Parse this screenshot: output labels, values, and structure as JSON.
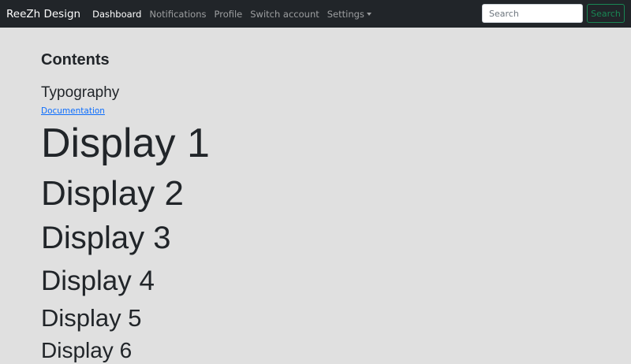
{
  "navbar": {
    "brand": "ReeZh Design",
    "links": [
      {
        "label": "Dashboard",
        "active": true
      },
      {
        "label": "Notifications",
        "active": false
      },
      {
        "label": "Profile",
        "active": false
      },
      {
        "label": "Switch account",
        "active": false
      },
      {
        "label": "Settings",
        "active": false,
        "dropdown": true
      }
    ],
    "search": {
      "placeholder": "Search",
      "value": "",
      "button_label": "Search"
    }
  },
  "main": {
    "title": "Contents",
    "section_title": "Typography",
    "documentation_link": "Documentation",
    "displays": [
      "Display 1",
      "Display 2",
      "Display 3",
      "Display 4",
      "Display 5",
      "Display 6"
    ]
  },
  "colors": {
    "navbar_bg": "#212529",
    "page_bg": "#e0e0e0",
    "link": "#0d6efd",
    "success": "#198754"
  }
}
